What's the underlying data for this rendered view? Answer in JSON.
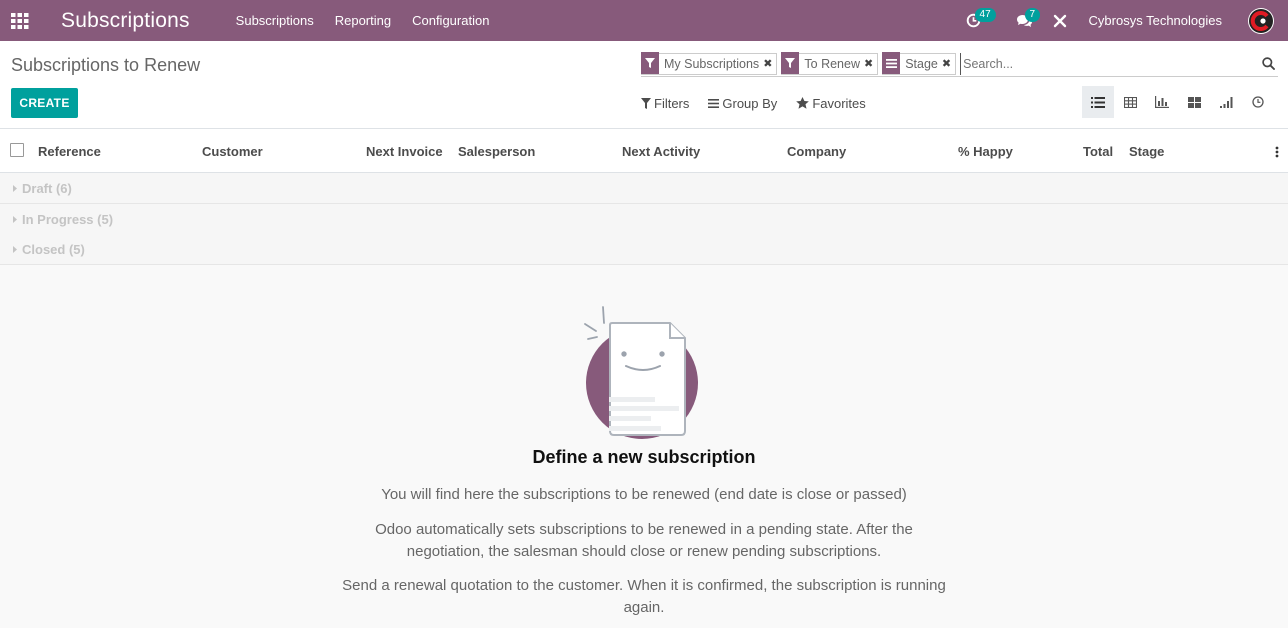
{
  "navbar": {
    "app_title": "Subscriptions",
    "menu": [
      "Subscriptions",
      "Reporting",
      "Configuration"
    ],
    "activity_count": "47",
    "messages_count": "7",
    "company": "Cybrosys Technologies",
    "color": "#875a7b"
  },
  "control": {
    "breadcrumb": "Subscriptions to Renew",
    "create_label": "CREATE",
    "facets": [
      {
        "icon": "filter-icon",
        "value": "My Subscriptions"
      },
      {
        "icon": "filter-icon",
        "value": "To Renew"
      },
      {
        "icon": "group-by-icon",
        "value": "Stage"
      }
    ],
    "search_placeholder": "Search...",
    "filters_label": "Filters",
    "groupby_label": "Group By",
    "favorites_label": "Favorites",
    "views": [
      "list-view-icon",
      "pivot-view-icon",
      "graph-view-icon",
      "kanban-view-icon",
      "cohort-view-icon",
      "activity-view-icon"
    ],
    "accent": "#00a09d"
  },
  "list": {
    "columns": [
      "Reference",
      "Customer",
      "Next Invoice",
      "Salesperson",
      "Next Activity",
      "Company",
      "% Happy",
      "Total",
      "Stage"
    ],
    "groups": [
      "Draft (6)",
      "In Progress (5)",
      "Closed (5)"
    ]
  },
  "help": {
    "title": "Define a new subscription",
    "p1": "You will find here the subscriptions to be renewed (end date is close or passed)",
    "p2": "Odoo automatically sets subscriptions to be renewed in a pending state. After the negotiation, the salesman should close or renew pending subscriptions.",
    "p3": "Send a renewal quotation to the customer. When it is confirmed, the subscription is running again."
  }
}
